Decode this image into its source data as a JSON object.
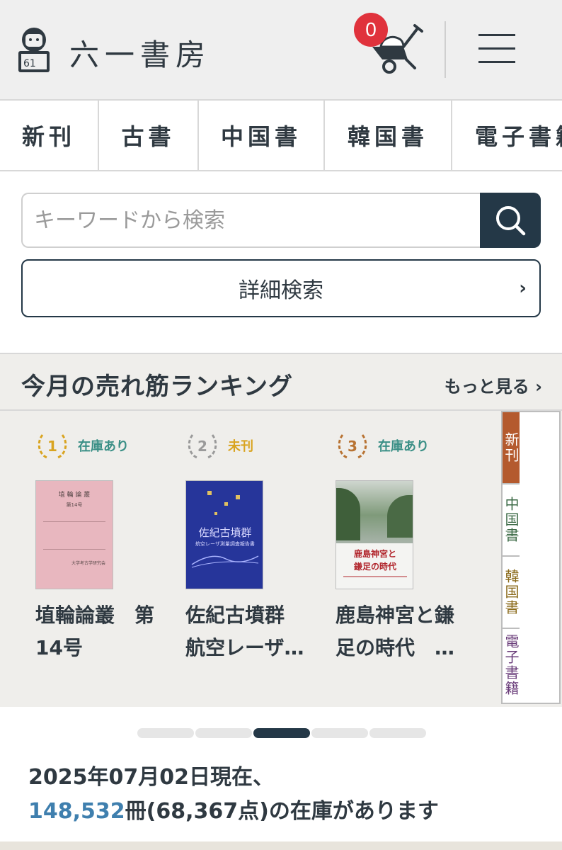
{
  "header": {
    "logo_text": "六一書房",
    "logo_number": "61",
    "cart_count": "0",
    "icons": {
      "logo": "reading-person-logo",
      "cart": "wheelbarrow-cart-icon",
      "menu": "hamburger-menu-icon"
    }
  },
  "category_tabs": [
    "新刊",
    "古書",
    "中国書",
    "韓国書",
    "電子書籍"
  ],
  "search": {
    "placeholder": "キーワードから検索",
    "advanced_label": "詳細検索",
    "advanced_chevron": "›"
  },
  "ranking": {
    "title": "今月の売れ筋ランキング",
    "more_label": "もっと見る ›",
    "books": [
      {
        "rank": "1",
        "stock": "在庫あり",
        "title": "埴輪論叢　第14号",
        "cover": {
          "heading": "埴 輪 論 叢",
          "sub": "第14号",
          "footer": "大学考古学研究会"
        }
      },
      {
        "rank": "2",
        "stock": "未刊",
        "title": "佐紀古墳群　航空レーザ…",
        "cover": {
          "heading": "佐紀古墳群",
          "sub": "航空レーザ測量調査報告書"
        }
      },
      {
        "rank": "3",
        "stock": "在庫あり",
        "title": "鹿島神宮と鎌足の時代　…",
        "cover": {
          "heading": "鹿島神宮と",
          "sub": "鎌足の時代"
        }
      }
    ],
    "side_tabs": [
      "新刊",
      "中国書",
      "韓国書",
      "電子書籍"
    ]
  },
  "inventory": {
    "date_line": "2025年07月02日現在、",
    "count": "148,532",
    "rest": "冊(68,367点)の在庫があります"
  },
  "colors": {
    "accent": "#243847",
    "cart_badge": "#e0323c",
    "rank1": "#d9a420",
    "rank2": "#9a9a9a",
    "rank3": "#b87333",
    "stock_available": "#3a8f86",
    "stock_unreleased": "#d9a420",
    "side_active": "#b45a2e",
    "count_blue": "#3f7fae"
  }
}
